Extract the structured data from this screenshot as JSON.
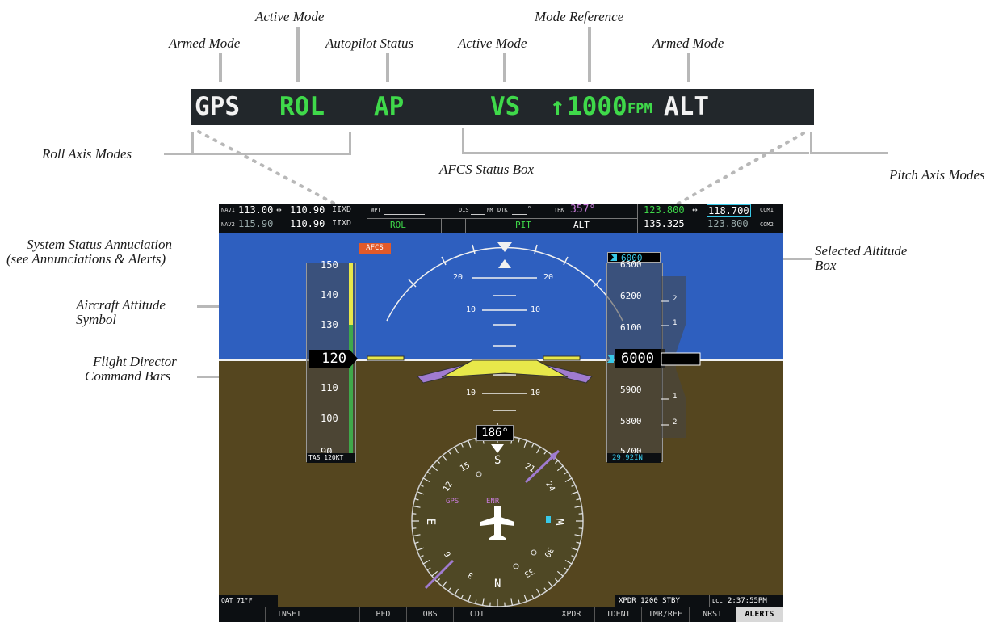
{
  "callouts": {
    "armed_mode_roll": "Armed Mode",
    "active_mode_roll": "Active Mode",
    "autopilot_status": "Autopilot Status",
    "active_mode_pitch": "Active Mode",
    "mode_reference": "Mode Reference",
    "armed_mode_pitch": "Armed Mode",
    "roll_axis_modes": "Roll Axis Modes",
    "afcs_status_box": "AFCS Status Box",
    "pitch_axis_modes": "Pitch Axis Modes",
    "system_status_line1": "System Status Annuciation",
    "system_status_line2": "(see Annunciations & Alerts)",
    "selected_alt_line1": "Selected Altitude",
    "selected_alt_line2": "Box",
    "attitude_symbol_line1": "Aircraft Attitude",
    "attitude_symbol_line2": "Symbol",
    "fd_line1": "Flight Director",
    "fd_line2": "Command Bars"
  },
  "afcs_strip": {
    "roll_armed": "GPS",
    "roll_active": "ROL",
    "ap_status": "AP",
    "pitch_active": "VS",
    "vs_arrow": "↑",
    "vs_value": "1000",
    "vs_unit": "FPM",
    "pitch_armed": "ALT"
  },
  "pfd": {
    "nav1_label": "NAV1",
    "nav1_active": "113.00",
    "nav1_swap": "↔",
    "nav1_standby": "110.90",
    "nav1_ident": "IIXD",
    "nav2_label": "NAV2",
    "nav2_active": "115.90",
    "nav2_standby": "110.90",
    "nav2_ident": "IIXD",
    "wpt_label": "WPT",
    "dis_label": "DIS",
    "nm_label": "NM",
    "dtk_label": "DTK",
    "deg": "°",
    "trk_label": "TRK",
    "trk_value": "357°",
    "com1_active": "123.800",
    "com_swap": "↔",
    "com1_standby": "118.700",
    "com1_label": "COM1",
    "com2_active": "135.325",
    "com2_standby": "123.800",
    "com2_label": "COM2",
    "afcs_roll": "ROL",
    "afcs_pitch": "PIT",
    "afcs_alt": "ALT",
    "annunciation": "AFCS",
    "airspeed_current": "120",
    "airspeed_ticks": [
      "150",
      "140",
      "130",
      "110",
      "100",
      "90"
    ],
    "tas": "TAS 120KT",
    "pitch_labels": [
      "20",
      "20",
      "10",
      "10",
      "10",
      "10"
    ],
    "selected_altitude": "6000",
    "altitude_current": "6000",
    "altitude_ticks": [
      "6300",
      "6200",
      "6100",
      "5900",
      "5800",
      "5700"
    ],
    "altitude_roll_above": "6100",
    "altitude_roll_below": "5900",
    "baro": "29.92IN",
    "vsi_ticks": [
      "2",
      "1",
      "1",
      "2"
    ],
    "heading": "186°",
    "compass_n": "N",
    "compass_s": "S",
    "compass_e": "E",
    "compass_w": "W",
    "compass_nums": [
      "15",
      "21",
      "24",
      "30",
      "33",
      "3",
      "6",
      "12"
    ],
    "gps_label": "GPS",
    "enr_label": "ENR",
    "oat": "OAT  71°F",
    "xpdr": "XPDR  1200  STBY",
    "lcl": "LCL",
    "time": "2:37:55PM",
    "softkeys": [
      "",
      "INSET",
      "",
      "PFD",
      "OBS",
      "CDI",
      "",
      "XPDR",
      "IDENT",
      "TMR/REF",
      "NRST",
      "ALERTS"
    ]
  },
  "colors": {
    "strip_green": "#3fd94a",
    "strip_white": "#f2f2f2",
    "sky": "#2e5fbf",
    "ground": "#55461f",
    "fd_bars": "#a07bd0",
    "attitude_symbol": "#e8e84a",
    "annunciation": "#e25a2a",
    "cyan": "#39c9e8"
  }
}
